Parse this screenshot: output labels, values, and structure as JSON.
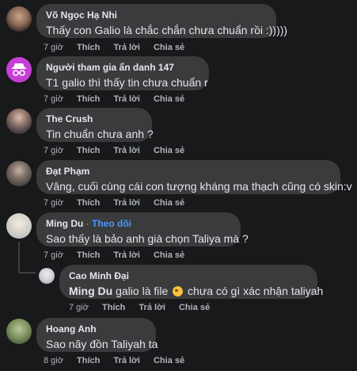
{
  "actions": {
    "like": "Thích",
    "reply": "Trả lời",
    "share": "Chia sẻ"
  },
  "comments": [
    {
      "name": "Võ Ngọc Hạ Nhi",
      "text": "Thấy con Galio là chắc chắn chưa chuẩn rồi :)))))",
      "time": "7 giờ"
    },
    {
      "name": "Người tham gia ẩn danh 147",
      "text": "T1 galio thì thấy tin chưa chuẩn r",
      "time": "7 giờ"
    },
    {
      "name": "The Crush",
      "text": "Tin chuẩn chưa anh ?",
      "time": "7 giờ"
    },
    {
      "name": "Đạt Phạm",
      "text": "Vâng, cuối cùng cái con tượng kháng ma thạch cũng có skin:v",
      "time": "7 giờ"
    },
    {
      "name": "Ming Du",
      "follow": "Theo dõi",
      "separator": "·",
      "text": "Sao thấy là bảo anh già chọn Taliya mà ?",
      "time": "7 giờ"
    },
    {
      "name": "Cao Minh Đại",
      "mention": "Ming Du",
      "text_a": "galio là file",
      "text_b": "chưa có gì xác nhận taliyah",
      "time": "7 giờ"
    },
    {
      "name": "Hoang Anh",
      "text": "Sao nãy đồn Taliyah ta",
      "time": "8 giờ"
    }
  ]
}
